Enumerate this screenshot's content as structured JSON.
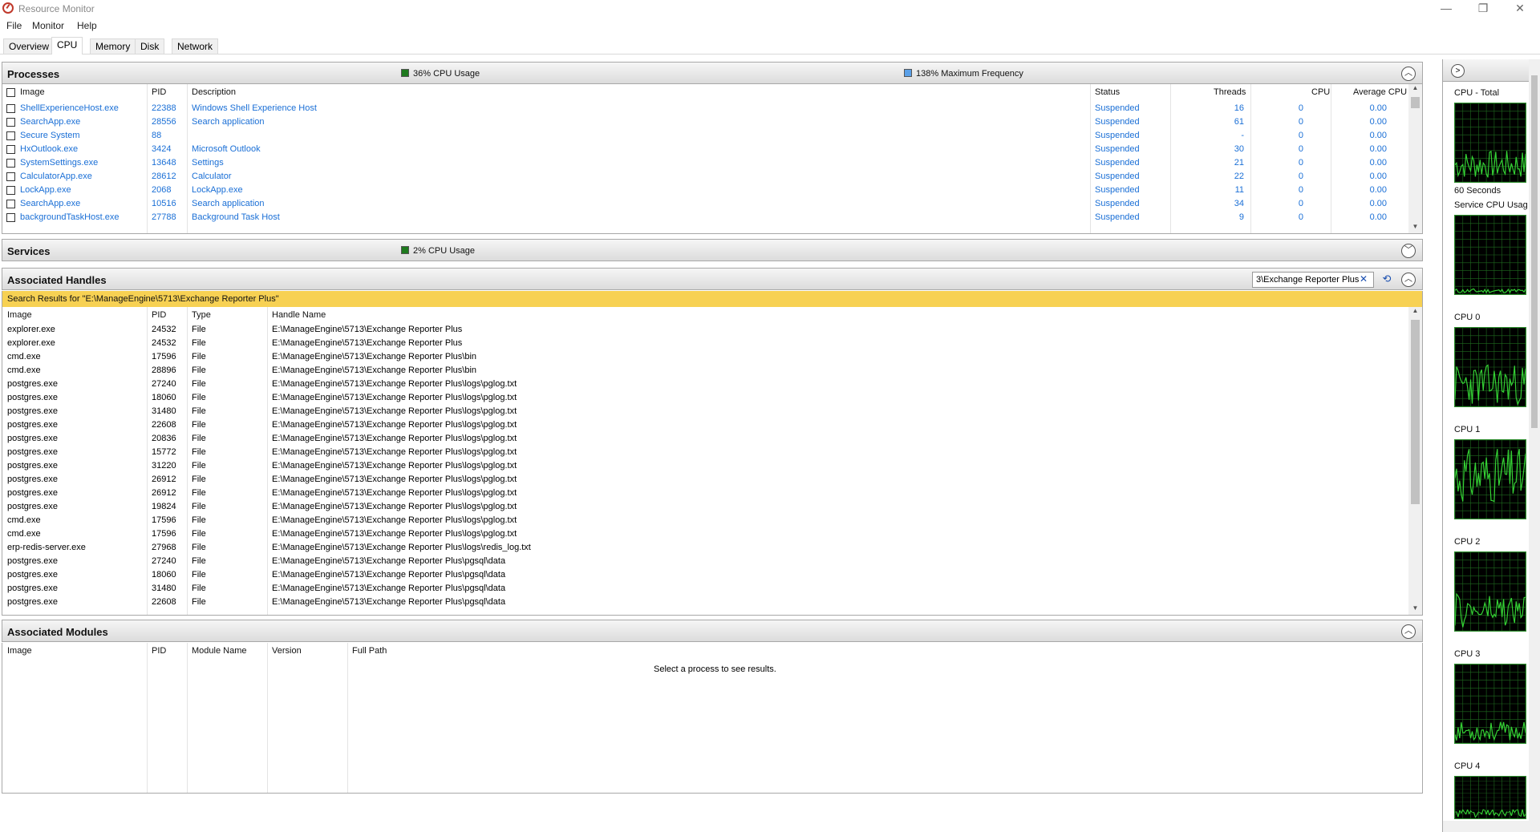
{
  "window": {
    "title": "Resource Monitor",
    "minimize": "—",
    "restore": "❐",
    "close": "✕"
  },
  "menu": [
    "File",
    "Monitor",
    "Help"
  ],
  "tabs": [
    "Overview",
    "CPU",
    "Memory",
    "Disk",
    "Network"
  ],
  "active_tab": "CPU",
  "processes": {
    "title": "Processes",
    "cpu_usage": "36% CPU Usage",
    "max_freq": "138% Maximum Frequency",
    "columns": [
      "Image",
      "PID",
      "Description",
      "Status",
      "Threads",
      "CPU",
      "Average CPU"
    ],
    "rows": [
      {
        "image": "ShellExperienceHost.exe",
        "pid": "22388",
        "desc": "Windows Shell Experience Host",
        "status": "Suspended",
        "threads": "16",
        "cpu": "0",
        "avg": "0.00"
      },
      {
        "image": "SearchApp.exe",
        "pid": "28556",
        "desc": "Search application",
        "status": "Suspended",
        "threads": "61",
        "cpu": "0",
        "avg": "0.00"
      },
      {
        "image": "Secure System",
        "pid": "88",
        "desc": "",
        "status": "Suspended",
        "threads": "-",
        "cpu": "0",
        "avg": "0.00"
      },
      {
        "image": "HxOutlook.exe",
        "pid": "3424",
        "desc": "Microsoft Outlook",
        "status": "Suspended",
        "threads": "30",
        "cpu": "0",
        "avg": "0.00"
      },
      {
        "image": "SystemSettings.exe",
        "pid": "13648",
        "desc": "Settings",
        "status": "Suspended",
        "threads": "21",
        "cpu": "0",
        "avg": "0.00"
      },
      {
        "image": "CalculatorApp.exe",
        "pid": "28612",
        "desc": "Calculator",
        "status": "Suspended",
        "threads": "22",
        "cpu": "0",
        "avg": "0.00"
      },
      {
        "image": "LockApp.exe",
        "pid": "2068",
        "desc": "LockApp.exe",
        "status": "Suspended",
        "threads": "11",
        "cpu": "0",
        "avg": "0.00"
      },
      {
        "image": "SearchApp.exe",
        "pid": "10516",
        "desc": "Search application",
        "status": "Suspended",
        "threads": "34",
        "cpu": "0",
        "avg": "0.00"
      },
      {
        "image": "backgroundTaskHost.exe",
        "pid": "27788",
        "desc": "Background Task Host",
        "status": "Suspended",
        "threads": "9",
        "cpu": "0",
        "avg": "0.00"
      }
    ]
  },
  "services": {
    "title": "Services",
    "cpu_usage": "2% CPU Usage"
  },
  "handles": {
    "title": "Associated Handles",
    "search_value": "3\\Exchange Reporter Plus",
    "banner": "Search Results for \"E:\\ManageEngine\\5713\\Exchange Reporter Plus\"",
    "columns": [
      "Image",
      "PID",
      "Type",
      "Handle Name"
    ],
    "rows": [
      {
        "image": "explorer.exe",
        "pid": "24532",
        "type": "File",
        "name": "E:\\ManageEngine\\5713\\Exchange Reporter Plus"
      },
      {
        "image": "explorer.exe",
        "pid": "24532",
        "type": "File",
        "name": "E:\\ManageEngine\\5713\\Exchange Reporter Plus"
      },
      {
        "image": "cmd.exe",
        "pid": "17596",
        "type": "File",
        "name": "E:\\ManageEngine\\5713\\Exchange Reporter Plus\\bin"
      },
      {
        "image": "cmd.exe",
        "pid": "28896",
        "type": "File",
        "name": "E:\\ManageEngine\\5713\\Exchange Reporter Plus\\bin"
      },
      {
        "image": "postgres.exe",
        "pid": "27240",
        "type": "File",
        "name": "E:\\ManageEngine\\5713\\Exchange Reporter Plus\\logs\\pglog.txt"
      },
      {
        "image": "postgres.exe",
        "pid": "18060",
        "type": "File",
        "name": "E:\\ManageEngine\\5713\\Exchange Reporter Plus\\logs\\pglog.txt"
      },
      {
        "image": "postgres.exe",
        "pid": "31480",
        "type": "File",
        "name": "E:\\ManageEngine\\5713\\Exchange Reporter Plus\\logs\\pglog.txt"
      },
      {
        "image": "postgres.exe",
        "pid": "22608",
        "type": "File",
        "name": "E:\\ManageEngine\\5713\\Exchange Reporter Plus\\logs\\pglog.txt"
      },
      {
        "image": "postgres.exe",
        "pid": "20836",
        "type": "File",
        "name": "E:\\ManageEngine\\5713\\Exchange Reporter Plus\\logs\\pglog.txt"
      },
      {
        "image": "postgres.exe",
        "pid": "15772",
        "type": "File",
        "name": "E:\\ManageEngine\\5713\\Exchange Reporter Plus\\logs\\pglog.txt"
      },
      {
        "image": "postgres.exe",
        "pid": "31220",
        "type": "File",
        "name": "E:\\ManageEngine\\5713\\Exchange Reporter Plus\\logs\\pglog.txt"
      },
      {
        "image": "postgres.exe",
        "pid": "26912",
        "type": "File",
        "name": "E:\\ManageEngine\\5713\\Exchange Reporter Plus\\logs\\pglog.txt"
      },
      {
        "image": "postgres.exe",
        "pid": "26912",
        "type": "File",
        "name": "E:\\ManageEngine\\5713\\Exchange Reporter Plus\\logs\\pglog.txt"
      },
      {
        "image": "postgres.exe",
        "pid": "19824",
        "type": "File",
        "name": "E:\\ManageEngine\\5713\\Exchange Reporter Plus\\logs\\pglog.txt"
      },
      {
        "image": "cmd.exe",
        "pid": "17596",
        "type": "File",
        "name": "E:\\ManageEngine\\5713\\Exchange Reporter Plus\\logs\\pglog.txt"
      },
      {
        "image": "cmd.exe",
        "pid": "17596",
        "type": "File",
        "name": "E:\\ManageEngine\\5713\\Exchange Reporter Plus\\logs\\pglog.txt"
      },
      {
        "image": "erp-redis-server.exe",
        "pid": "27968",
        "type": "File",
        "name": "E:\\ManageEngine\\5713\\Exchange Reporter Plus\\logs\\redis_log.txt"
      },
      {
        "image": "postgres.exe",
        "pid": "27240",
        "type": "File",
        "name": "E:\\ManageEngine\\5713\\Exchange Reporter Plus\\pgsql\\data"
      },
      {
        "image": "postgres.exe",
        "pid": "18060",
        "type": "File",
        "name": "E:\\ManageEngine\\5713\\Exchange Reporter Plus\\pgsql\\data"
      },
      {
        "image": "postgres.exe",
        "pid": "31480",
        "type": "File",
        "name": "E:\\ManageEngine\\5713\\Exchange Reporter Plus\\pgsql\\data"
      },
      {
        "image": "postgres.exe",
        "pid": "22608",
        "type": "File",
        "name": "E:\\ManageEngine\\5713\\Exchange Reporter Plus\\pgsql\\data"
      }
    ]
  },
  "modules": {
    "title": "Associated Modules",
    "columns": [
      "Image",
      "PID",
      "Module Name",
      "Version",
      "Full Path"
    ],
    "empty_message": "Select a process to see results."
  },
  "graphs": {
    "cpu_total": "CPU - Total",
    "seconds": "60 Seconds",
    "service_cpu": "Service CPU Usag",
    "cpu0": "CPU 0",
    "cpu1": "CPU 1",
    "cpu2": "CPU 2",
    "cpu3": "CPU 3",
    "cpu4": "CPU 4"
  },
  "colors": {
    "accent_blue": "#1a6fd6",
    "cpu_green": "#1e7a1e",
    "freq_blue": "#5aa0e8",
    "banner_yellow": "#f7d153",
    "graph_line": "#35d435"
  },
  "icons": {
    "collapse": "chevron-up-icon",
    "expand": "chevron-down-icon",
    "clear": "close-icon",
    "refresh": "refresh-icon",
    "pane_toggle": "chevron-right-icon"
  }
}
